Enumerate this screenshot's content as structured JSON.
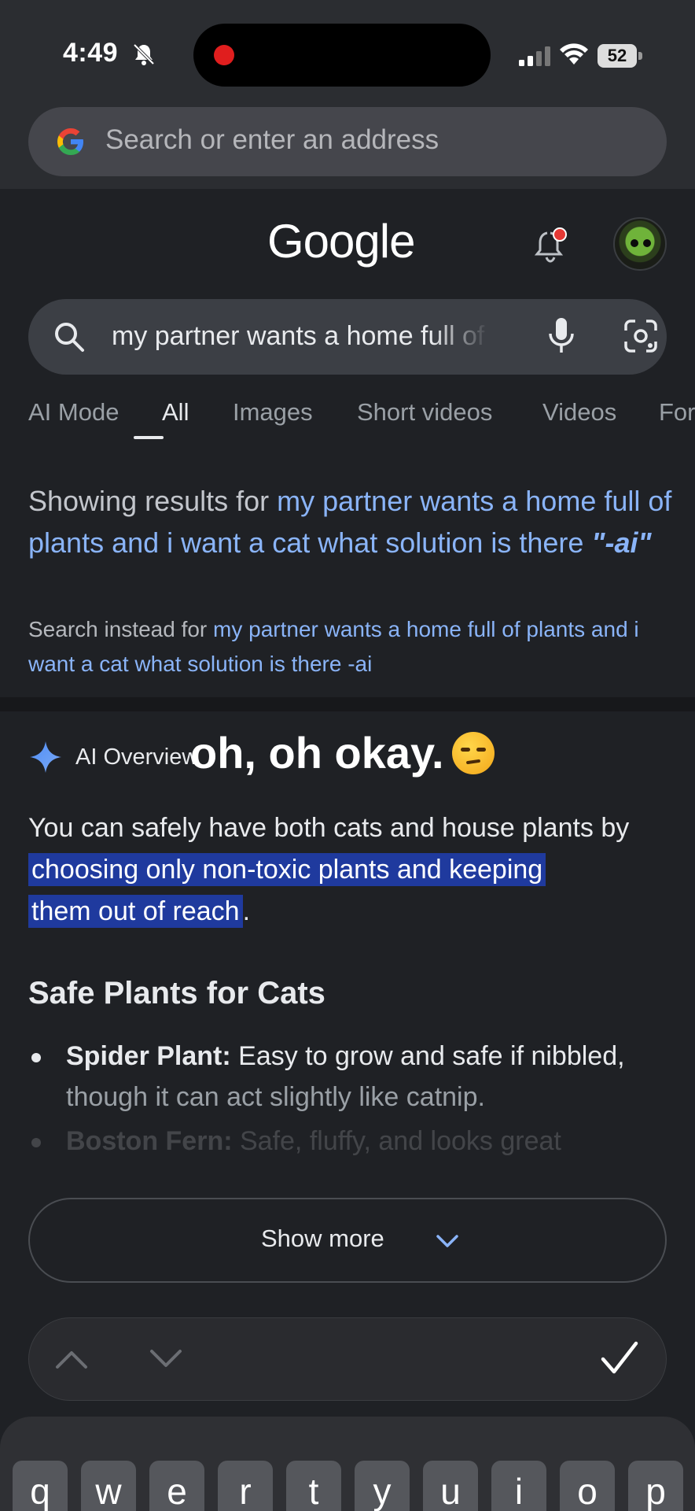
{
  "status_bar": {
    "time": "4:49",
    "battery": "52"
  },
  "address_bar": {
    "placeholder": "Search or enter an address"
  },
  "google": {
    "logo": "Google",
    "search_query": "my partner wants a home full of plants and i want a cat what solution is there -ai",
    "tabs": [
      "AI Mode",
      "All",
      "Images",
      "Short videos",
      "Videos",
      "For"
    ],
    "active_tab": "All"
  },
  "correction": {
    "prefix": "Showing results for ",
    "corrected_query": "my partner wants a home full of plants and i want a cat what solution is there ",
    "quoted_term": "\"-ai\"",
    "instead_prefix": "Search instead for ",
    "original_query": "my partner wants a home full of plants and i want a cat what solution is there -ai"
  },
  "ai_overview": {
    "label": "AI Overview",
    "caption_overlay": "oh, oh okay.",
    "answer_prefix": "You can safely have both cats and house plants by ",
    "answer_highlight_1": "choosing only non-toxic plants and keeping",
    "answer_highlight_2": "them out of reach",
    "answer_suffix": ".",
    "section_heading": "Safe Plants for Cats",
    "bullets": [
      {
        "title": "Spider Plant:",
        "text_1": " Easy to grow and safe if nibbled,",
        "text_2": "though it can act slightly like catnip."
      },
      {
        "title": "Boston Fern:",
        "text_1": " Safe, fluffy, and looks great"
      }
    ],
    "show_more": "Show more"
  },
  "keyboard": {
    "keys": [
      "q",
      "w",
      "e",
      "r",
      "t",
      "y",
      "u",
      "i",
      "o",
      "p"
    ]
  },
  "colors": {
    "link": "#8ab4f8",
    "highlight": "#1f3a9e",
    "background": "#1f2125"
  }
}
